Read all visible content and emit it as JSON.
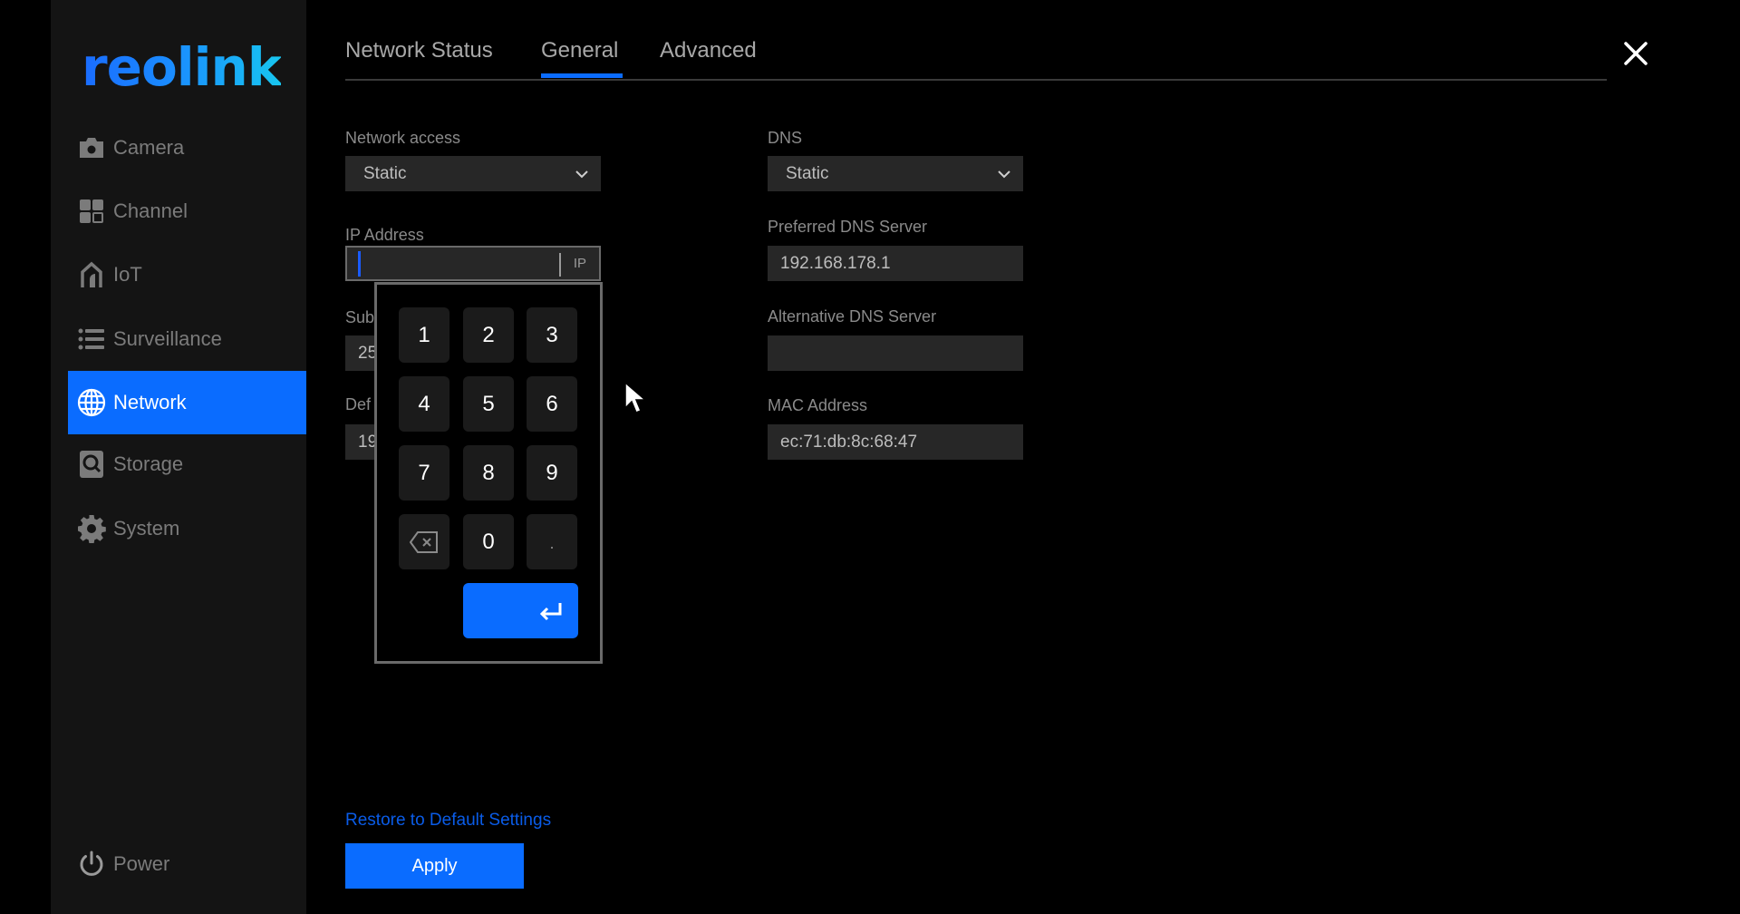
{
  "brand": {
    "logo_text": "reolink",
    "accent": "#0a6cff"
  },
  "sidebar": {
    "items": [
      {
        "label": "Camera",
        "icon": "camera-icon",
        "active": false
      },
      {
        "label": "Channel",
        "icon": "channel-grid-icon",
        "active": false
      },
      {
        "label": "IoT",
        "icon": "iot-home-icon",
        "active": false
      },
      {
        "label": "Surveillance",
        "icon": "list-icon",
        "active": false
      },
      {
        "label": "Network",
        "icon": "globe-icon",
        "active": true
      },
      {
        "label": "Storage",
        "icon": "storage-icon",
        "active": false
      },
      {
        "label": "System",
        "icon": "gear-icon",
        "active": false
      }
    ],
    "power": {
      "label": "Power",
      "icon": "power-icon"
    }
  },
  "tabs": [
    {
      "label": "Network Status",
      "active": false
    },
    {
      "label": "General",
      "active": true
    },
    {
      "label": "Advanced",
      "active": false
    }
  ],
  "close_icon": "close-icon",
  "form": {
    "network_access": {
      "label": "Network access",
      "value": "Static"
    },
    "ip_address": {
      "label": "IP Address",
      "value": "",
      "tag": "IP"
    },
    "subnet_mask": {
      "label_visible": "Sub",
      "value_visible": "25"
    },
    "default_gateway": {
      "label_visible": "Def",
      "value_visible": "19"
    },
    "dns": {
      "label": "DNS",
      "value": "Static"
    },
    "preferred_dns": {
      "label": "Preferred DNS Server",
      "value": "192.168.178.1"
    },
    "alternative_dns": {
      "label": "Alternative DNS Server",
      "value": ""
    },
    "mac_address": {
      "label": "MAC Address",
      "value": "ec:71:db:8c:68:47"
    }
  },
  "keypad": {
    "keys": [
      "1",
      "2",
      "3",
      "4",
      "5",
      "6",
      "7",
      "8",
      "9",
      "backspace",
      "0",
      "."
    ],
    "enter_icon": "enter-icon",
    "backspace_icon": "backspace-icon"
  },
  "footer": {
    "restore_label": "Restore to Default Settings",
    "apply_label": "Apply"
  }
}
